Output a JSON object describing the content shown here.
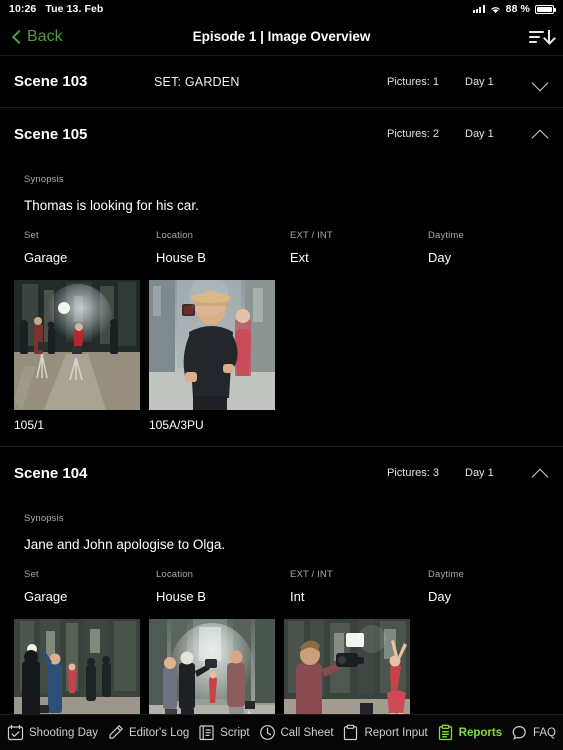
{
  "status_bar": {
    "time": "10:26",
    "date": "Tue 13. Feb",
    "battery_percent": "88 %",
    "signal_icon": "cellular-signal-icon",
    "wifi_icon": "wifi-icon",
    "battery_icon": "battery-icon"
  },
  "nav": {
    "back_label": "Back",
    "back_icon": "chevron-left-icon",
    "title": "Episode 1 | Image Overview",
    "sort_icon": "sort-descending-icon",
    "accent_green": "#4e9e3e"
  },
  "labels": {
    "synopsis": "Synopsis",
    "set": "Set",
    "location": "Location",
    "ext_int": "EXT / INT",
    "daytime": "Daytime",
    "pictures_prefix": "Pictures:"
  },
  "scenes": [
    {
      "title": "Scene 103",
      "set_banner": "SET: GARDEN",
      "pictures": "Pictures: 1",
      "day": "Day 1",
      "expanded": false,
      "chevron_icon": "chevron-down-icon"
    },
    {
      "title": "Scene 105",
      "set_banner": "",
      "pictures": "Pictures: 2",
      "day": "Day 1",
      "expanded": true,
      "chevron_icon": "chevron-up-icon",
      "synopsis": "Thomas is looking for his car.",
      "set": "Garage",
      "location": "House B",
      "ext_int": "Ext",
      "daytime": "Day",
      "images": [
        {
          "caption": "105/1",
          "alt": "film-set-crew-wide-shot"
        },
        {
          "caption": "105A/3PU",
          "alt": "actor-in-hat-holding-camera"
        }
      ]
    },
    {
      "title": "Scene 104",
      "set_banner": "",
      "pictures": "Pictures: 3",
      "day": "Day 1",
      "expanded": true,
      "chevron_icon": "chevron-up-icon",
      "synopsis": "Jane and John apologise to Olga.",
      "set": "Garage",
      "location": "House B",
      "ext_int": "Int",
      "daytime": "Day",
      "images": [
        {
          "caption": "",
          "alt": "crew-filming-in-factory-hall"
        },
        {
          "caption": "",
          "alt": "crew-and-dancer-in-smoke"
        },
        {
          "caption": "",
          "alt": "camera-operator-filming-dancer"
        }
      ]
    }
  ],
  "tabbar": {
    "active": "Reports",
    "active_color": "#80e03a",
    "items": [
      {
        "label": "Shooting Day",
        "icon": "calendar-check-icon",
        "active": false
      },
      {
        "label": "Editor's Log",
        "icon": "pencil-icon",
        "active": false
      },
      {
        "label": "Script",
        "icon": "script-document-icon",
        "active": false
      },
      {
        "label": "Call Sheet",
        "icon": "clock-icon",
        "active": false
      },
      {
        "label": "Report Input",
        "icon": "clipboard-icon",
        "active": false
      },
      {
        "label": "Reports",
        "icon": "clipboard-lines-icon",
        "active": true
      },
      {
        "label": "FAQ",
        "icon": "speech-bubble-icon",
        "active": false
      }
    ]
  }
}
